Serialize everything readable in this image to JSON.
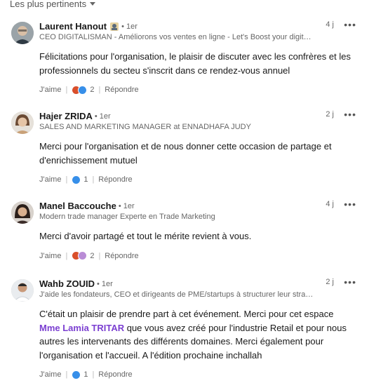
{
  "sort_label": "Les plus pertinents",
  "colors": {
    "mention": "#7b3fd1",
    "like": "#378fe9",
    "celebrate": "#d94f2b",
    "support": "#b98cd6"
  },
  "comments": [
    {
      "name": "Laurent Hanout",
      "degree": "• 1er",
      "headline": "CEO DIGITALISMAN - Améliorons vos ventes en ligne - Let's Boost your digit…",
      "time": "4 j",
      "text": "Félicitations pour l'organisation, le plaisir de discuter avec les confrères et les professionnels du secteu s'inscrit dans ce rendez-vous annuel",
      "like_label": "J'aime",
      "reaction_count": "2",
      "reply_label": "Répondre"
    },
    {
      "name": "Hajer ZRIDA",
      "degree": "• 1er",
      "headline": "SALES AND MARKETING MANAGER at ENNADHAFA JUDY",
      "time": "2 j",
      "text": "Merci pour l'organisation et de nous donner cette occasion de partage et d'enrichissement mutuel",
      "like_label": "J'aime",
      "reaction_count": "1",
      "reply_label": "Répondre"
    },
    {
      "name": "Manel Baccouche",
      "degree": "• 1er",
      "headline": "Modern trade manager Experte en Trade Marketing",
      "time": "4 j",
      "text": "Merci d'avoir partagé et tout le mérite revient à vous.",
      "like_label": "J'aime",
      "reaction_count": "2",
      "reply_label": "Répondre"
    },
    {
      "name": "Wahb ZOUID",
      "degree": "• 1er",
      "headline": "J'aide les fondateurs, CEO et dirigeants de PME/startups à structurer leur stra…",
      "time": "2 j",
      "text_before": "C'était un plaisir de prendre part à cet événement. Merci pour cet espace ",
      "mention": "Mme Lamia TRITAR",
      "text_after": " que vous avez créé pour l'industrie Retail et pour nous autres les intervenants des différents domaines. Merci également pour l'organisation et l'accueil. A l'édition prochaine inchallah",
      "like_label": "J'aime",
      "reaction_count": "1",
      "reply_label": "Répondre"
    }
  ]
}
